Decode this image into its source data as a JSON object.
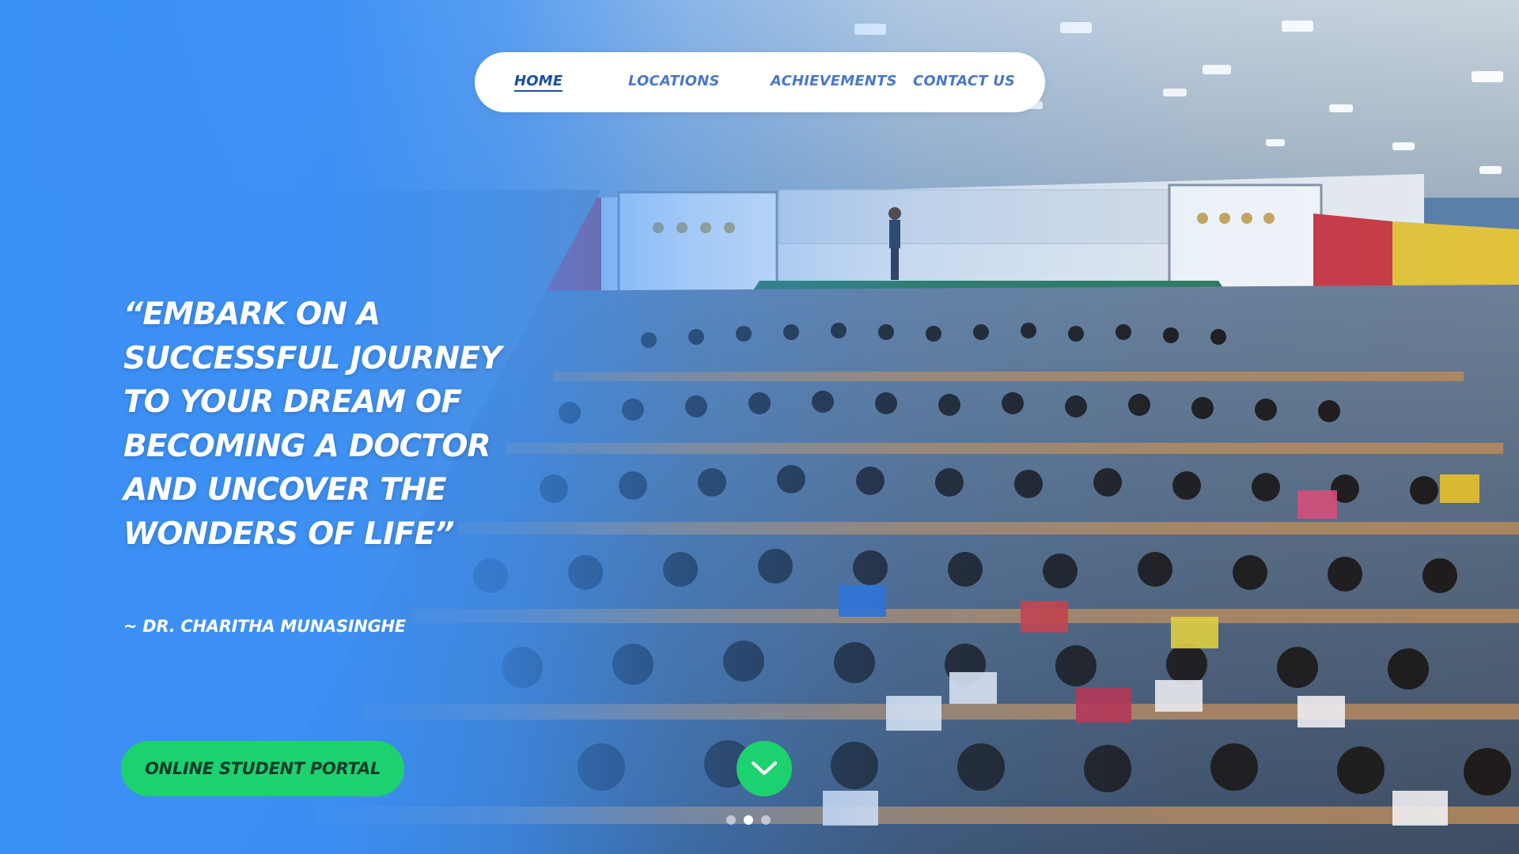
{
  "nav": {
    "items": [
      {
        "label": "HOME",
        "active": true
      },
      {
        "label": "LOCATIONS",
        "active": false
      },
      {
        "label": "ACHIEVEMENTS",
        "active": false
      },
      {
        "label": "CONTACT US",
        "active": false
      }
    ]
  },
  "hero": {
    "quote_lines": [
      "“EMBARK ON A",
      "SUCCESSFUL JOURNEY",
      "TO YOUR DREAM OF",
      "BECOMING A DOCTOR",
      "AND UNCOVER THE",
      "WONDERS OF LIFE”"
    ],
    "author": "~ DR. CHARITHA MUNASINGHE",
    "portal_button": "ONLINE STUDENT PORTAL",
    "scroll_icon": "chevron-down-icon",
    "slides": {
      "count": 3,
      "active_index": 1
    }
  },
  "colors": {
    "overlay_blue": "#3b90f6",
    "accent_green": "#1ed16f",
    "nav_text": "#4a78c9",
    "nav_active": "#1a4fa3"
  }
}
